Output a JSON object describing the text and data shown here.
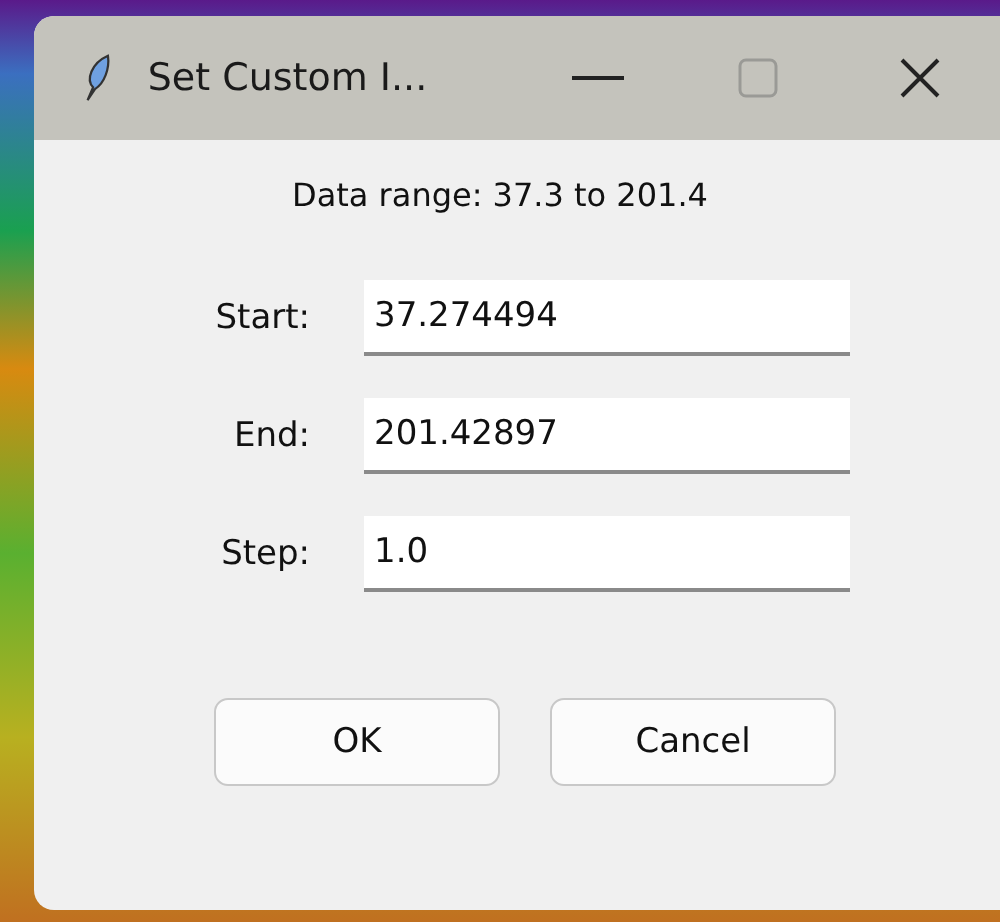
{
  "window": {
    "title": "Set Custom I..."
  },
  "range_text": "Data range: 37.3 to 201.4",
  "fields": [
    {
      "label": "Start:",
      "value": "37.274494"
    },
    {
      "label": "End:",
      "value": "201.42897"
    },
    {
      "label": "Step:",
      "value": "1.0"
    }
  ],
  "buttons": [
    "OK",
    "Cancel"
  ]
}
